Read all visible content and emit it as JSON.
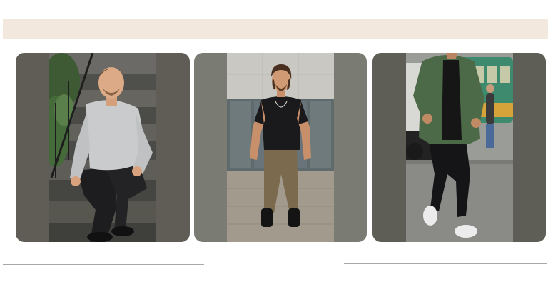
{
  "banner": {
    "color": "#f3e8de"
  },
  "gallery": {
    "cards": [
      {
        "icon": "man-sitting-on-stairs-photo",
        "background": "#5f5d55"
      },
      {
        "icon": "man-standing-black-tshirt-photo",
        "background": "#7a7b73"
      },
      {
        "icon": "man-walking-green-jacket-photo",
        "background": "#5f5e56"
      }
    ]
  },
  "dividers": {
    "color": "#a9a9a9"
  }
}
